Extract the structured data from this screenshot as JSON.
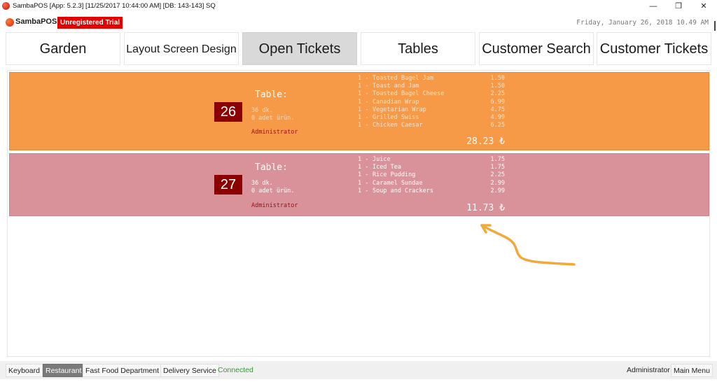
{
  "window": {
    "title": "SambaPOS [App: 5.2.3] [11/25/2017 10:44:00 AM] [DB: 143-143] SQ",
    "icon": "sambapos-app-icon",
    "minimize": "—",
    "restore": "❐",
    "close": "✕"
  },
  "brand": {
    "name": "SambaPOS",
    "badge": "Unregistered Trial",
    "date": "Friday, January 26, 2018 10.49 AM"
  },
  "nav": {
    "garden": "Garden",
    "layout_screen_design": "Layout Screen Design",
    "open_tickets": "Open Tickets",
    "tables": "Tables",
    "customer_search": "Customer Search",
    "customer_tickets": "Customer Tickets",
    "active": "Open Tickets"
  },
  "tickets": [
    {
      "label": "Table:",
      "number": "26",
      "minutes": "36 dk.",
      "products": "0 adet ürün.",
      "user": "Administrator",
      "items": [
        {
          "qty": "1 -",
          "name": "Toasted Bagel Jam",
          "price": "1.50"
        },
        {
          "qty": "1 -",
          "name": "Toast and Jam",
          "price": "1.50"
        },
        {
          "qty": "1 -",
          "name": "Toasted Bagel Cheese",
          "price": "2.25"
        },
        {
          "qty": "1 -",
          "name": "Canadian Wrap",
          "price": "6.99"
        },
        {
          "qty": "1 -",
          "name": "Vegetarian Wrap",
          "price": "4.75"
        },
        {
          "qty": "1 -",
          "name": "Grilled Swiss",
          "price": "4.99"
        },
        {
          "qty": "1 -",
          "name": "Chicken Caesar",
          "price": "6.25"
        }
      ],
      "total": "28.23 ₺",
      "color": "#f79a48"
    },
    {
      "label": "Table:",
      "number": "27",
      "minutes": "36 dk.",
      "products": "0 adet ürün.",
      "user": "Administrator",
      "items": [
        {
          "qty": "1 -",
          "name": "Juice",
          "price": "1.75"
        },
        {
          "qty": "1 -",
          "name": "Iced Tea",
          "price": "1.75"
        },
        {
          "qty": "1 -",
          "name": "Rice Pudding",
          "price": "2.25"
        },
        {
          "qty": "1 -",
          "name": "Caramel Sundae",
          "price": "2.99"
        },
        {
          "qty": "1 -",
          "name": "Soup and Crackers",
          "price": "2.99"
        }
      ],
      "total": "11.73 ₺",
      "color": "#d9929a"
    }
  ],
  "annotation": {
    "icon": "arrow-annotation-icon",
    "color": "#f2a93b"
  },
  "statusbar": {
    "keyboard": "Keyboard",
    "restaurant": "Restaurant",
    "fast_food": "Fast Food Department",
    "delivery": "Delivery Service",
    "connection": "Connected",
    "connection_color": "#2e9e2e",
    "user": "Administrator",
    "main_menu": "Main Menu"
  }
}
